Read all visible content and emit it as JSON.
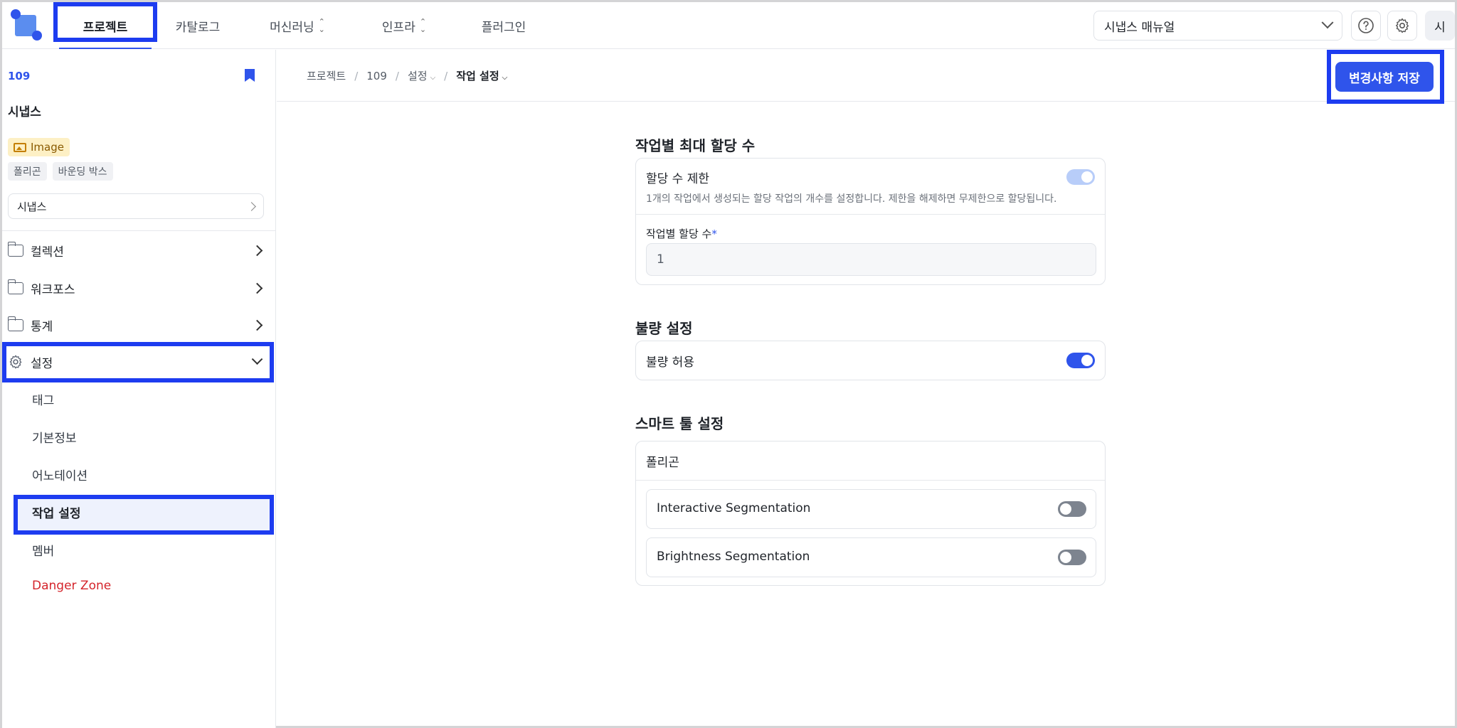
{
  "topnav": {
    "items": [
      {
        "label": "프로젝트"
      },
      {
        "label": "카탈로그"
      },
      {
        "label": "머신러닝"
      },
      {
        "label": "인프라"
      },
      {
        "label": "플러그인"
      }
    ],
    "manual_select": "시냅스 매뉴얼",
    "avatar": "시"
  },
  "sidebar": {
    "project_id": "109",
    "project_name": "시냅스",
    "type_badge": "Image",
    "tags": [
      "폴리곤",
      "바운딩 박스"
    ],
    "workspace": "시냅스",
    "menu": [
      {
        "label": "컬렉션"
      },
      {
        "label": "워크포스"
      },
      {
        "label": "통계"
      },
      {
        "label": "설정"
      }
    ],
    "settings_sub": [
      {
        "label": "태그"
      },
      {
        "label": "기본정보"
      },
      {
        "label": "어노테이션"
      },
      {
        "label": "작업 설정"
      },
      {
        "label": "멤버"
      },
      {
        "label": "Danger Zone"
      }
    ]
  },
  "breadcrumb": [
    "프로젝트",
    "109",
    "설정",
    "작업 설정"
  ],
  "save_button": "변경사항 저장",
  "sections": {
    "max_assign": {
      "title": "작업별 최대 할당 수",
      "limit_label": "할당 수 제한",
      "limit_desc": "1개의 작업에서 생성되는 할당 작업의 개수를 설정합니다. 제한을 해제하면 무제한으로 할당됩니다.",
      "limit_on": true,
      "count_label": "작업별 할당 수",
      "count_required": "*",
      "count_value": "1"
    },
    "defect": {
      "title": "불량 설정",
      "allow_label": "불량 허용",
      "allow_on": true
    },
    "smart_tool": {
      "title": "스마트 툴 설정",
      "group_label": "폴리곤",
      "tools": [
        {
          "label": "Interactive Segmentation",
          "on": false
        },
        {
          "label": "Brightness Segmentation",
          "on": false
        }
      ]
    }
  },
  "colors": {
    "accent": "#2f54eb",
    "highlight": "#1d3cf0",
    "danger": "#d4242b"
  }
}
